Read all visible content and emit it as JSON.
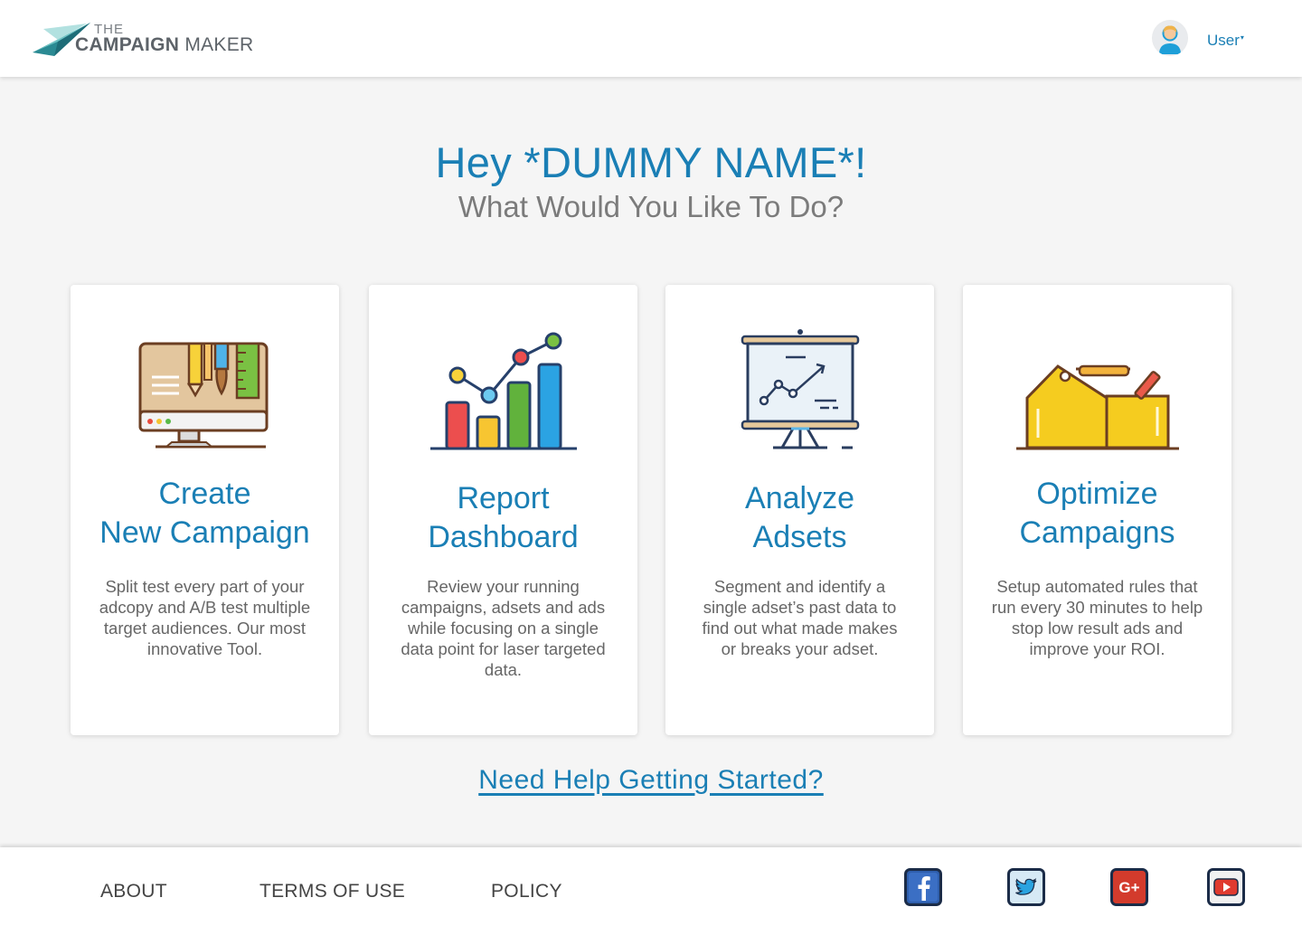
{
  "header": {
    "logo_the": "THE",
    "logo_campaign": "CAMPAIGN",
    "logo_maker": "MAKER",
    "user_label": "User",
    "caret": "▾"
  },
  "hero": {
    "greeting": "Hey *DUMMY NAME*!",
    "subheading": "What Would You Like To Do?"
  },
  "cards": [
    {
      "icon": "monitor-design-icon",
      "title_line1": "Create",
      "title_line2": "New Campaign",
      "description": "Split test every part of your adcopy and A/B test multiple target audiences. Our most innovative Tool."
    },
    {
      "icon": "bar-chart-icon",
      "title_line1": "Report",
      "title_line2": "Dashboard",
      "description": "Review your running campaigns, adsets and ads while focusing on a single data point for laser targeted data."
    },
    {
      "icon": "presentation-board-icon",
      "title_line1": "Analyze",
      "title_line2": "Adsets",
      "description": "Segment and identify a single adset’s past data to find out what made makes or breaks your adset."
    },
    {
      "icon": "toolbox-icon",
      "title_line1": "Optimize",
      "title_line2": "Campaigns",
      "description": "Setup automated rules that run every 30 minutes to help stop low result ads and improve your ROI."
    }
  ],
  "help": {
    "label": "Need Help Getting Started?"
  },
  "footer": {
    "links": [
      "ABOUT",
      "TERMS OF USE",
      "POLICY"
    ],
    "social": [
      "facebook-icon",
      "twitter-icon",
      "google-plus-icon",
      "youtube-icon"
    ]
  },
  "colors": {
    "brand_blue": "#1a7fb5",
    "background": "#f5f5f5",
    "text_gray": "#666666"
  }
}
